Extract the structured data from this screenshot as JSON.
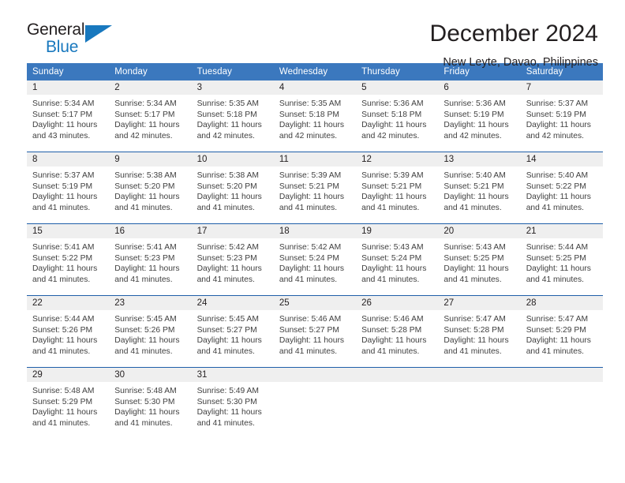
{
  "brand": {
    "line1": "General",
    "line2": "Blue",
    "triangle_icon": "blue-triangle",
    "accent_color": "#1878be"
  },
  "header": {
    "title": "December 2024",
    "subtitle": "New Leyte, Davao, Philippines"
  },
  "calendar": {
    "header_color": "#3b78be",
    "daynum_band_color": "#efefef",
    "weekday_headers": [
      "Sunday",
      "Monday",
      "Tuesday",
      "Wednesday",
      "Thursday",
      "Friday",
      "Saturday"
    ],
    "weeks": [
      [
        {
          "day": "1",
          "sunrise": "Sunrise: 5:34 AM",
          "sunset": "Sunset: 5:17 PM",
          "daylight_line1": "Daylight: 11 hours",
          "daylight_line2": "and 43 minutes."
        },
        {
          "day": "2",
          "sunrise": "Sunrise: 5:34 AM",
          "sunset": "Sunset: 5:17 PM",
          "daylight_line1": "Daylight: 11 hours",
          "daylight_line2": "and 42 minutes."
        },
        {
          "day": "3",
          "sunrise": "Sunrise: 5:35 AM",
          "sunset": "Sunset: 5:18 PM",
          "daylight_line1": "Daylight: 11 hours",
          "daylight_line2": "and 42 minutes."
        },
        {
          "day": "4",
          "sunrise": "Sunrise: 5:35 AM",
          "sunset": "Sunset: 5:18 PM",
          "daylight_line1": "Daylight: 11 hours",
          "daylight_line2": "and 42 minutes."
        },
        {
          "day": "5",
          "sunrise": "Sunrise: 5:36 AM",
          "sunset": "Sunset: 5:18 PM",
          "daylight_line1": "Daylight: 11 hours",
          "daylight_line2": "and 42 minutes."
        },
        {
          "day": "6",
          "sunrise": "Sunrise: 5:36 AM",
          "sunset": "Sunset: 5:19 PM",
          "daylight_line1": "Daylight: 11 hours",
          "daylight_line2": "and 42 minutes."
        },
        {
          "day": "7",
          "sunrise": "Sunrise: 5:37 AM",
          "sunset": "Sunset: 5:19 PM",
          "daylight_line1": "Daylight: 11 hours",
          "daylight_line2": "and 42 minutes."
        }
      ],
      [
        {
          "day": "8",
          "sunrise": "Sunrise: 5:37 AM",
          "sunset": "Sunset: 5:19 PM",
          "daylight_line1": "Daylight: 11 hours",
          "daylight_line2": "and 41 minutes."
        },
        {
          "day": "9",
          "sunrise": "Sunrise: 5:38 AM",
          "sunset": "Sunset: 5:20 PM",
          "daylight_line1": "Daylight: 11 hours",
          "daylight_line2": "and 41 minutes."
        },
        {
          "day": "10",
          "sunrise": "Sunrise: 5:38 AM",
          "sunset": "Sunset: 5:20 PM",
          "daylight_line1": "Daylight: 11 hours",
          "daylight_line2": "and 41 minutes."
        },
        {
          "day": "11",
          "sunrise": "Sunrise: 5:39 AM",
          "sunset": "Sunset: 5:21 PM",
          "daylight_line1": "Daylight: 11 hours",
          "daylight_line2": "and 41 minutes."
        },
        {
          "day": "12",
          "sunrise": "Sunrise: 5:39 AM",
          "sunset": "Sunset: 5:21 PM",
          "daylight_line1": "Daylight: 11 hours",
          "daylight_line2": "and 41 minutes."
        },
        {
          "day": "13",
          "sunrise": "Sunrise: 5:40 AM",
          "sunset": "Sunset: 5:21 PM",
          "daylight_line1": "Daylight: 11 hours",
          "daylight_line2": "and 41 minutes."
        },
        {
          "day": "14",
          "sunrise": "Sunrise: 5:40 AM",
          "sunset": "Sunset: 5:22 PM",
          "daylight_line1": "Daylight: 11 hours",
          "daylight_line2": "and 41 minutes."
        }
      ],
      [
        {
          "day": "15",
          "sunrise": "Sunrise: 5:41 AM",
          "sunset": "Sunset: 5:22 PM",
          "daylight_line1": "Daylight: 11 hours",
          "daylight_line2": "and 41 minutes."
        },
        {
          "day": "16",
          "sunrise": "Sunrise: 5:41 AM",
          "sunset": "Sunset: 5:23 PM",
          "daylight_line1": "Daylight: 11 hours",
          "daylight_line2": "and 41 minutes."
        },
        {
          "day": "17",
          "sunrise": "Sunrise: 5:42 AM",
          "sunset": "Sunset: 5:23 PM",
          "daylight_line1": "Daylight: 11 hours",
          "daylight_line2": "and 41 minutes."
        },
        {
          "day": "18",
          "sunrise": "Sunrise: 5:42 AM",
          "sunset": "Sunset: 5:24 PM",
          "daylight_line1": "Daylight: 11 hours",
          "daylight_line2": "and 41 minutes."
        },
        {
          "day": "19",
          "sunrise": "Sunrise: 5:43 AM",
          "sunset": "Sunset: 5:24 PM",
          "daylight_line1": "Daylight: 11 hours",
          "daylight_line2": "and 41 minutes."
        },
        {
          "day": "20",
          "sunrise": "Sunrise: 5:43 AM",
          "sunset": "Sunset: 5:25 PM",
          "daylight_line1": "Daylight: 11 hours",
          "daylight_line2": "and 41 minutes."
        },
        {
          "day": "21",
          "sunrise": "Sunrise: 5:44 AM",
          "sunset": "Sunset: 5:25 PM",
          "daylight_line1": "Daylight: 11 hours",
          "daylight_line2": "and 41 minutes."
        }
      ],
      [
        {
          "day": "22",
          "sunrise": "Sunrise: 5:44 AM",
          "sunset": "Sunset: 5:26 PM",
          "daylight_line1": "Daylight: 11 hours",
          "daylight_line2": "and 41 minutes."
        },
        {
          "day": "23",
          "sunrise": "Sunrise: 5:45 AM",
          "sunset": "Sunset: 5:26 PM",
          "daylight_line1": "Daylight: 11 hours",
          "daylight_line2": "and 41 minutes."
        },
        {
          "day": "24",
          "sunrise": "Sunrise: 5:45 AM",
          "sunset": "Sunset: 5:27 PM",
          "daylight_line1": "Daylight: 11 hours",
          "daylight_line2": "and 41 minutes."
        },
        {
          "day": "25",
          "sunrise": "Sunrise: 5:46 AM",
          "sunset": "Sunset: 5:27 PM",
          "daylight_line1": "Daylight: 11 hours",
          "daylight_line2": "and 41 minutes."
        },
        {
          "day": "26",
          "sunrise": "Sunrise: 5:46 AM",
          "sunset": "Sunset: 5:28 PM",
          "daylight_line1": "Daylight: 11 hours",
          "daylight_line2": "and 41 minutes."
        },
        {
          "day": "27",
          "sunrise": "Sunrise: 5:47 AM",
          "sunset": "Sunset: 5:28 PM",
          "daylight_line1": "Daylight: 11 hours",
          "daylight_line2": "and 41 minutes."
        },
        {
          "day": "28",
          "sunrise": "Sunrise: 5:47 AM",
          "sunset": "Sunset: 5:29 PM",
          "daylight_line1": "Daylight: 11 hours",
          "daylight_line2": "and 41 minutes."
        }
      ],
      [
        {
          "day": "29",
          "sunrise": "Sunrise: 5:48 AM",
          "sunset": "Sunset: 5:29 PM",
          "daylight_line1": "Daylight: 11 hours",
          "daylight_line2": "and 41 minutes."
        },
        {
          "day": "30",
          "sunrise": "Sunrise: 5:48 AM",
          "sunset": "Sunset: 5:30 PM",
          "daylight_line1": "Daylight: 11 hours",
          "daylight_line2": "and 41 minutes."
        },
        {
          "day": "31",
          "sunrise": "Sunrise: 5:49 AM",
          "sunset": "Sunset: 5:30 PM",
          "daylight_line1": "Daylight: 11 hours",
          "daylight_line2": "and 41 minutes."
        },
        {
          "day": "",
          "sunrise": "",
          "sunset": "",
          "daylight_line1": "",
          "daylight_line2": ""
        },
        {
          "day": "",
          "sunrise": "",
          "sunset": "",
          "daylight_line1": "",
          "daylight_line2": ""
        },
        {
          "day": "",
          "sunrise": "",
          "sunset": "",
          "daylight_line1": "",
          "daylight_line2": ""
        },
        {
          "day": "",
          "sunrise": "",
          "sunset": "",
          "daylight_line1": "",
          "daylight_line2": ""
        }
      ]
    ]
  }
}
